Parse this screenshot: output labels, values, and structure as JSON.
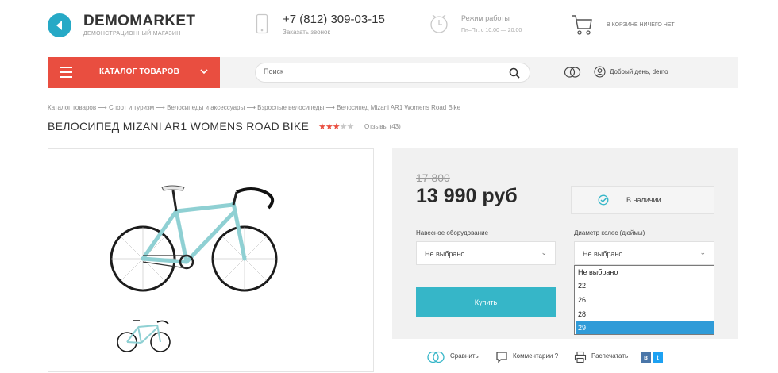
{
  "header": {
    "logo_name": "DEMOMARKET",
    "logo_sub": "ДЕМОНСТРАЦИОННЫЙ МАГАЗИН",
    "phone": "+7 (812) 309-03-15",
    "callback": "Заказать звонок",
    "hours_title": "Режим работы",
    "hours_value": "Пн–Пт: с 10:00 — 20:00",
    "cart_text": "В КОРЗИНЕ НИЧЕГО НЕТ"
  },
  "nav": {
    "catalog_label": "КАТАЛОГ ТОВАРОВ",
    "search_placeholder": "Поиск",
    "greeting": "Добрый день, demo"
  },
  "breadcrumb": "Каталог товаров ⟶ Спорт и туризм ⟶ Велосипеды и аксессуары ⟶ Взрослые велосипеды ⟶ Велосипед Mizani AR1 Womens Road Bike",
  "product": {
    "title": "ВЕЛОСИПЕД MIZANI AR1 WOMENS ROAD BIKE",
    "rating": 3,
    "rating_max": 5,
    "reviews": "Отзывы (43)",
    "old_price": "17 800",
    "price": "13 990 руб",
    "stock": "В наличии"
  },
  "options": {
    "equipment_label": "Навесное оборудование",
    "equipment_value": "Не выбрано",
    "wheel_label": "Диаметр колес (дюймы)",
    "wheel_value": "Не выбрано",
    "wheel_options": [
      "Не выбрано",
      "22",
      "26",
      "28",
      "29"
    ],
    "wheel_highlighted": "29"
  },
  "actions": {
    "buy": "Купить",
    "compare": "Сравнить",
    "comments": "Комментарии ?",
    "print": "Распечатать"
  },
  "colors": {
    "accent_red": "#e94e40",
    "accent_teal": "#36b6c8",
    "logo_blue": "#26a9c6",
    "select_blue": "#2f9bd8"
  }
}
